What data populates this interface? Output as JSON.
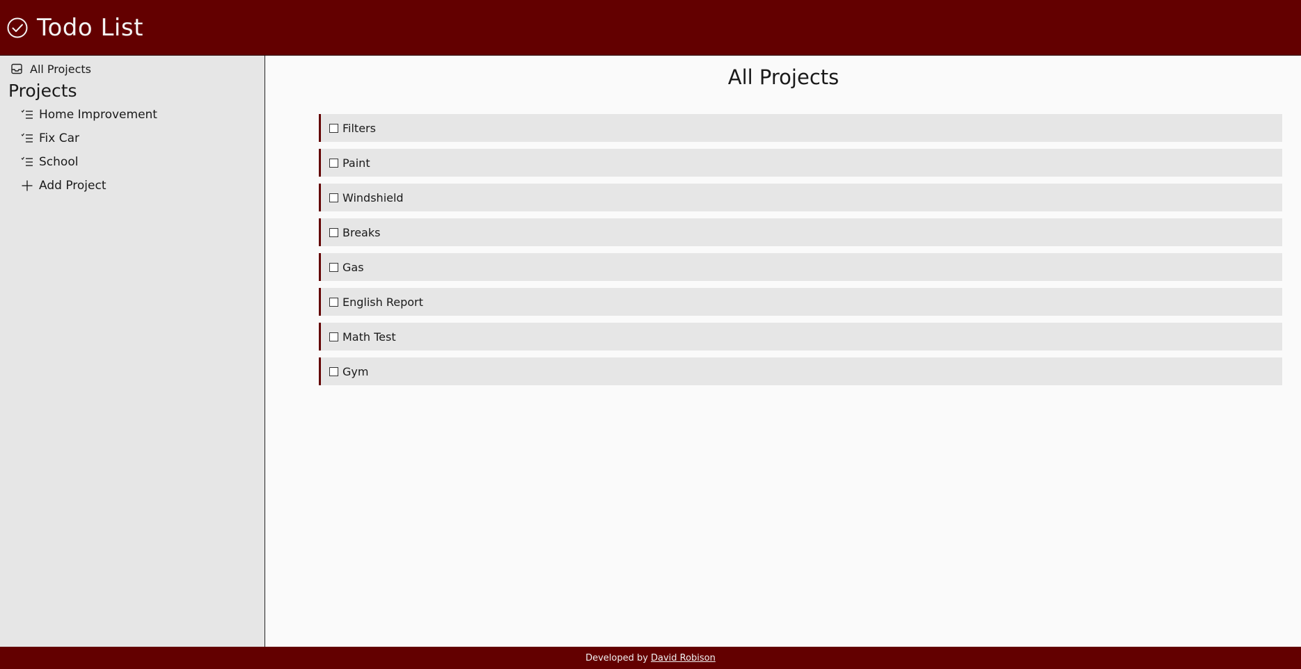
{
  "header": {
    "title": "Todo List",
    "icon": "check-circle-icon",
    "bg_color": "#630000"
  },
  "sidebar": {
    "all_projects": {
      "label": "All Projects",
      "icon": "inbox-icon"
    },
    "heading": "Projects",
    "projects": [
      {
        "label": "Home Improvement",
        "icon": "list-check-icon"
      },
      {
        "label": "Fix Car",
        "icon": "list-check-icon"
      },
      {
        "label": "School",
        "icon": "list-check-icon"
      }
    ],
    "add_project": {
      "label": "Add Project",
      "icon": "plus-icon"
    }
  },
  "main": {
    "title": "All Projects",
    "tasks": [
      {
        "label": "Filters"
      },
      {
        "label": "Paint"
      },
      {
        "label": "Windshield"
      },
      {
        "label": "Breaks"
      },
      {
        "label": "Gas"
      },
      {
        "label": "English Report"
      },
      {
        "label": "Math Test"
      },
      {
        "label": "Gym"
      }
    ]
  },
  "footer": {
    "prefix": "Developed by",
    "author": "David Robison"
  },
  "colors": {
    "accent": "#630000",
    "sidebar_bg": "#e6e6e6",
    "task_bg": "#e6e6e6"
  }
}
